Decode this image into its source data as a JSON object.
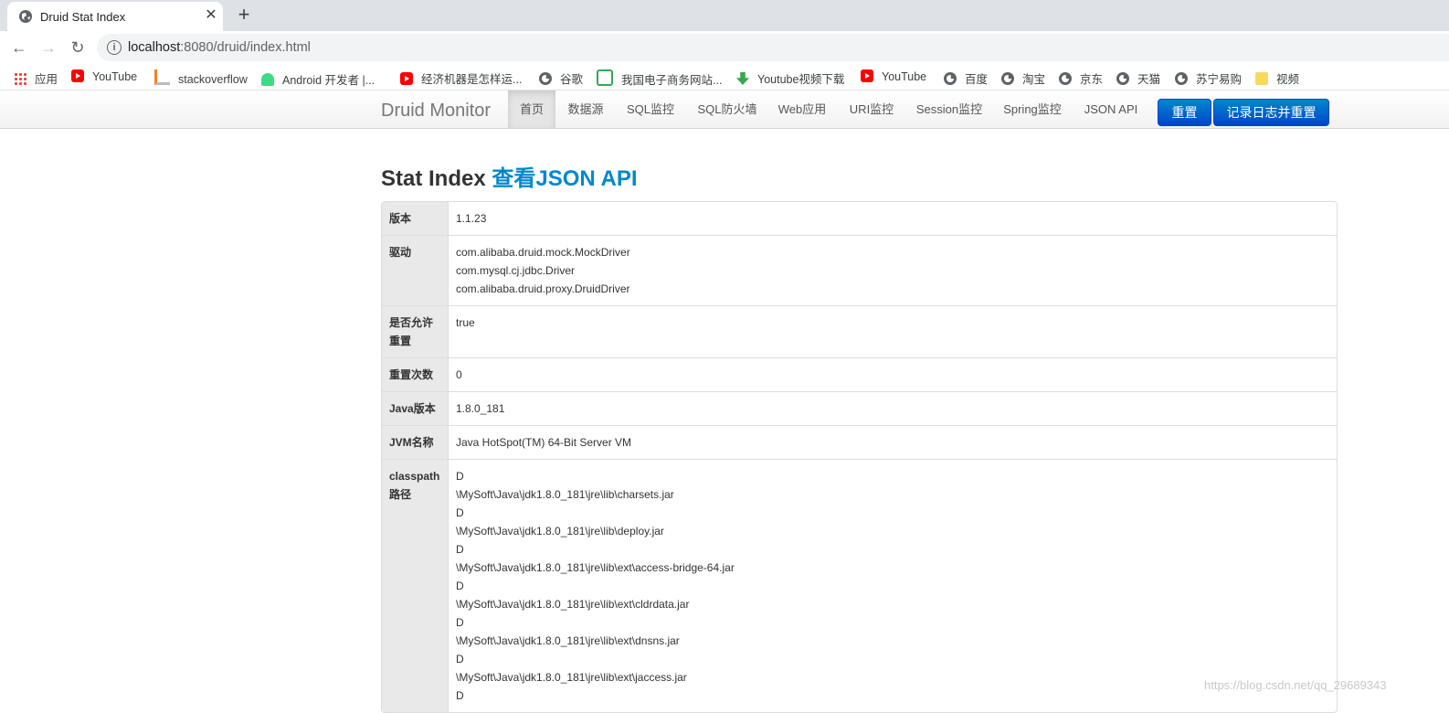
{
  "browser": {
    "tab_title": "Druid Stat Index",
    "url_host": "localhost",
    "url_rest": ":8080/druid/index.html"
  },
  "bookmarks": [
    {
      "label": "应用",
      "icon": "apps-grid-icon"
    },
    {
      "label": "YouTube",
      "icon": "youtube-icon"
    },
    {
      "label": "stackoverflow",
      "icon": "stackoverflow-icon"
    },
    {
      "label": "Android 开发者 |...",
      "icon": "android-icon"
    },
    {
      "label": "经济机器是怎样运...",
      "icon": "youtube-icon"
    },
    {
      "label": "谷歌",
      "icon": "globe-icon"
    },
    {
      "label": "我国电子商务网站...",
      "icon": "site-icon"
    },
    {
      "label": "Youtube视频下载",
      "icon": "download-icon"
    },
    {
      "label": "YouTube",
      "icon": "youtube-icon"
    },
    {
      "label": "百度",
      "icon": "globe-icon"
    },
    {
      "label": "淘宝",
      "icon": "globe-icon"
    },
    {
      "label": "京东",
      "icon": "globe-icon"
    },
    {
      "label": "天猫",
      "icon": "globe-icon"
    },
    {
      "label": "苏宁易购",
      "icon": "globe-icon"
    },
    {
      "label": "视频",
      "icon": "folder-icon"
    }
  ],
  "nav": {
    "brand": "Druid Monitor",
    "items": [
      "首页",
      "数据源",
      "SQL监控",
      "SQL防火墙",
      "Web应用",
      "URI监控",
      "Session监控",
      "Spring监控",
      "JSON API"
    ],
    "active_index": 0,
    "reset_button": "重置",
    "log_reset_button": "记录日志并重置",
    "button_color": "#0055cc"
  },
  "page": {
    "title": "Stat Index",
    "title_link": "查看JSON API"
  },
  "stats": [
    {
      "key": "版本",
      "lines": [
        "1.1.23"
      ]
    },
    {
      "key": "驱动",
      "lines": [
        "com.alibaba.druid.mock.MockDriver",
        "com.mysql.cj.jdbc.Driver",
        "com.alibaba.druid.proxy.DruidDriver"
      ]
    },
    {
      "key": "是否允许重置",
      "lines": [
        "true"
      ]
    },
    {
      "key": "重置次数",
      "lines": [
        "0"
      ]
    },
    {
      "key": "Java版本",
      "lines": [
        "1.8.0_181"
      ]
    },
    {
      "key": "JVM名称",
      "lines": [
        "Java HotSpot(TM) 64-Bit Server VM"
      ]
    },
    {
      "key": "classpath路径",
      "lines": [
        "D",
        "\\MySoft\\Java\\jdk1.8.0_181\\jre\\lib\\charsets.jar",
        "D",
        "\\MySoft\\Java\\jdk1.8.0_181\\jre\\lib\\deploy.jar",
        "D",
        "\\MySoft\\Java\\jdk1.8.0_181\\jre\\lib\\ext\\access-bridge-64.jar",
        "D",
        "\\MySoft\\Java\\jdk1.8.0_181\\jre\\lib\\ext\\cldrdata.jar",
        "D",
        "\\MySoft\\Java\\jdk1.8.0_181\\jre\\lib\\ext\\dnsns.jar",
        "D",
        "\\MySoft\\Java\\jdk1.8.0_181\\jre\\lib\\ext\\jaccess.jar",
        "D"
      ]
    }
  ],
  "watermark": "https://blog.csdn.net/qq_29689343"
}
